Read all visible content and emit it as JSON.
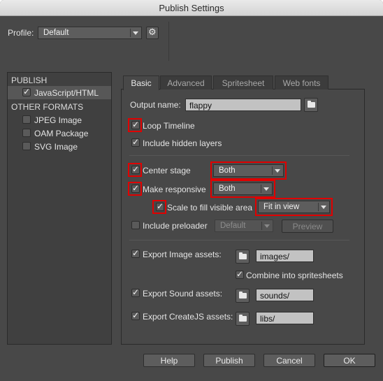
{
  "window": {
    "title": "Publish Settings"
  },
  "profile": {
    "label": "Profile:",
    "value": "Default"
  },
  "sidebar": {
    "publish_header": "PUBLISH",
    "publish_items": [
      {
        "label": "JavaScript/HTML",
        "checked": true,
        "selected": true
      }
    ],
    "other_header": "OTHER FORMATS",
    "other_items": [
      {
        "label": "JPEG Image",
        "checked": false
      },
      {
        "label": "OAM Package",
        "checked": false
      },
      {
        "label": "SVG Image",
        "checked": false
      }
    ]
  },
  "tabs": [
    {
      "label": "Basic",
      "active": true
    },
    {
      "label": "Advanced",
      "active": false
    },
    {
      "label": "Spritesheet",
      "active": false
    },
    {
      "label": "Web fonts",
      "active": false
    }
  ],
  "basic": {
    "output_name_label": "Output name:",
    "output_name_value": "flappy",
    "loop_timeline": {
      "label": "Loop Timeline",
      "checked": true
    },
    "include_hidden_layers": {
      "label": "Include hidden layers",
      "checked": true
    },
    "center_stage": {
      "label": "Center stage",
      "checked": true,
      "value": "Both"
    },
    "make_responsive": {
      "label": "Make responsive",
      "checked": true,
      "value": "Both"
    },
    "scale_to_fill": {
      "label": "Scale to fill visible area",
      "checked": true,
      "value": "Fit in view"
    },
    "include_preloader": {
      "label": "Include preloader",
      "checked": false,
      "value": "Default",
      "preview_label": "Preview"
    },
    "export_image": {
      "label": "Export Image assets:",
      "checked": true,
      "path": "images/"
    },
    "combine_spritesheets": {
      "label": "Combine into spritesheets",
      "checked": true
    },
    "export_sound": {
      "label": "Export Sound assets:",
      "checked": true,
      "path": "sounds/"
    },
    "export_createjs": {
      "label": "Export CreateJS assets:",
      "checked": true,
      "path": "libs/"
    }
  },
  "footer": {
    "help": "Help",
    "publish": "Publish",
    "cancel": "Cancel",
    "ok": "OK"
  },
  "colors": {
    "background": "#484848",
    "highlight_box": "#e00000"
  }
}
